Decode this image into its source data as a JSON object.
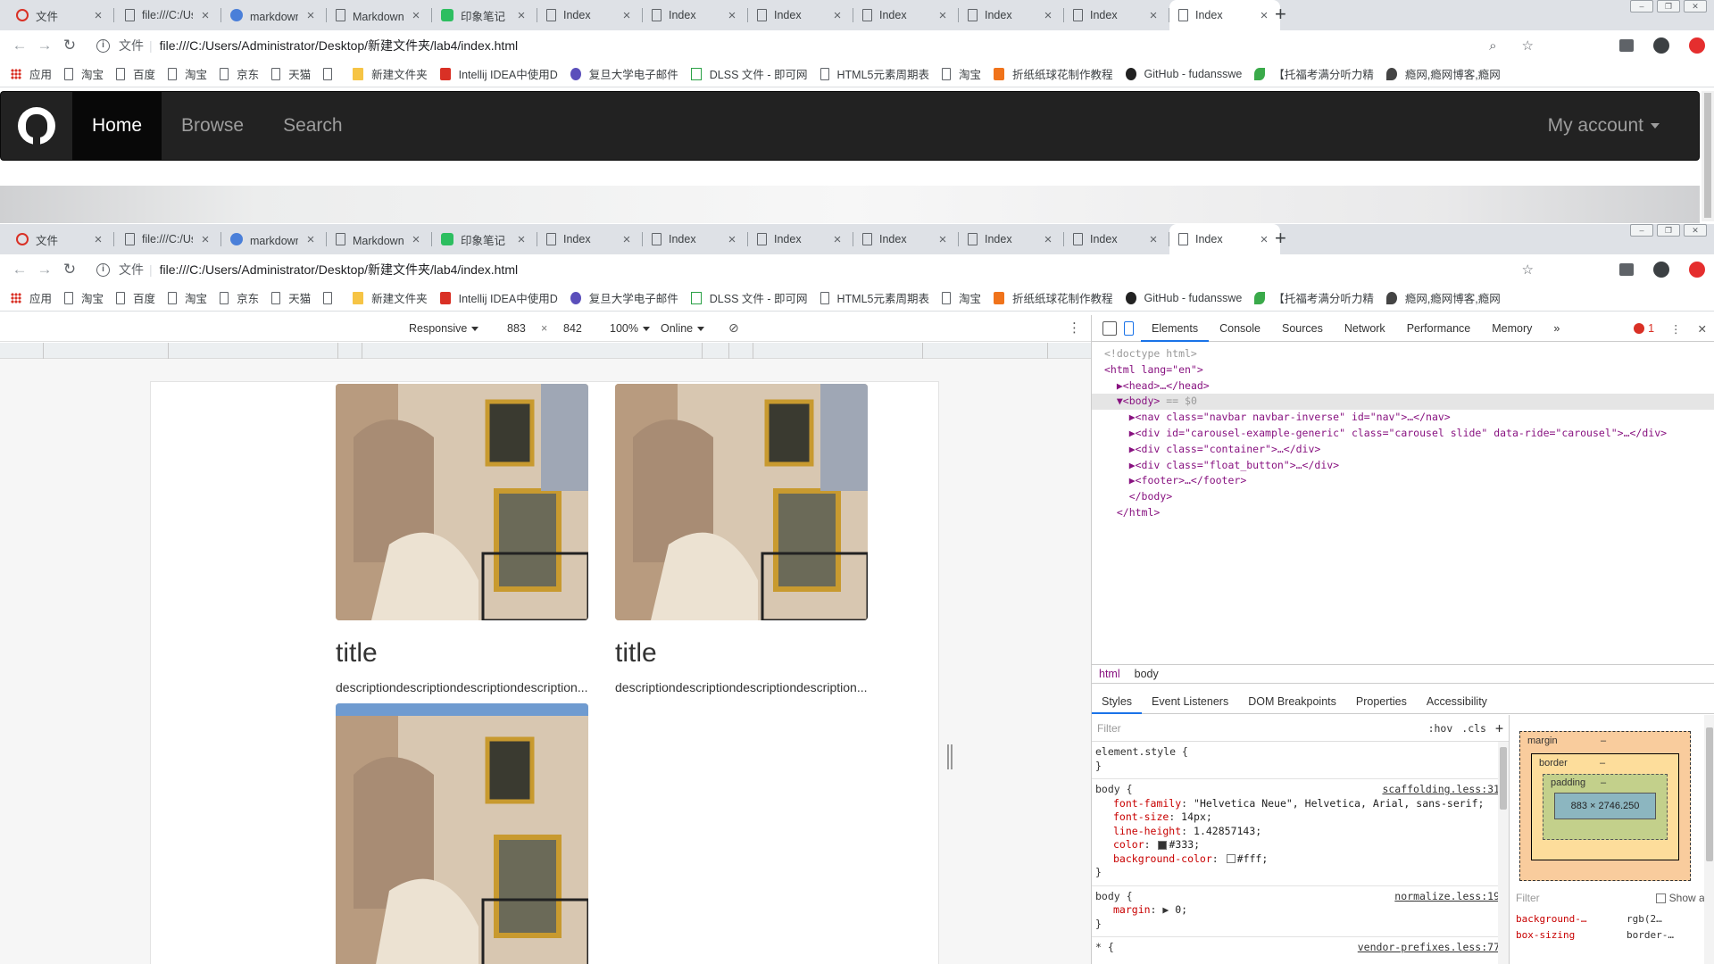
{
  "browser_top": {
    "tabs": [
      {
        "title": "文件",
        "icon": "red-circle-icon"
      },
      {
        "title": "file:///C:/User",
        "icon": "page-icon"
      },
      {
        "title": "markdown编辑",
        "icon": "paw-icon"
      },
      {
        "title": "Markdown在线",
        "icon": "page-icon"
      },
      {
        "title": "印象笔记 Mark",
        "icon": "evernote-icon"
      },
      {
        "title": "Index",
        "icon": "page-icon"
      },
      {
        "title": "Index",
        "icon": "page-icon"
      },
      {
        "title": "Index",
        "icon": "page-icon"
      },
      {
        "title": "Index",
        "icon": "page-icon"
      },
      {
        "title": "Index",
        "icon": "page-icon"
      },
      {
        "title": "Index",
        "icon": "page-icon"
      },
      {
        "title": "Index",
        "icon": "page-icon",
        "active": true
      }
    ],
    "url_scheme_label": "文件",
    "url": "file:///C:/Users/Administrator/Desktop/新建文件夹/lab4/index.html"
  },
  "bookmarks": [
    {
      "label": "应用",
      "icon": "apps-icon"
    },
    {
      "label": "淘宝",
      "icon": "page-icon"
    },
    {
      "label": "百度",
      "icon": "page-icon"
    },
    {
      "label": "淘宝",
      "icon": "page-icon"
    },
    {
      "label": "京东",
      "icon": "page-icon"
    },
    {
      "label": "天猫",
      "icon": "page-icon"
    },
    {
      "label": "",
      "icon": "page-icon"
    },
    {
      "label": "新建文件夹",
      "icon": "folder-icon"
    },
    {
      "label": "Intellij IDEA中使用D",
      "icon": "intellij-icon"
    },
    {
      "label": "复旦大学电子邮件",
      "icon": "globe-icon"
    },
    {
      "label": "DLSS 文件 - 即可网",
      "icon": "jk-icon"
    },
    {
      "label": "HTML5元素周期表",
      "icon": "page-icon"
    },
    {
      "label": "淘宝",
      "icon": "page-icon"
    },
    {
      "label": "折纸纸球花制作教程",
      "icon": "orange-icon"
    },
    {
      "label": "GitHub - fudansswe",
      "icon": "github-icon"
    },
    {
      "label": "【托福考满分听力精",
      "icon": "leaf-icon"
    },
    {
      "label": "瘾网,瘾网博客,瘾网",
      "icon": "chat-icon"
    }
  ],
  "site_navbar": {
    "brand": "github-logo-icon",
    "links": [
      {
        "label": "Home",
        "active": true
      },
      {
        "label": "Browse",
        "active": false
      },
      {
        "label": "Search",
        "active": false
      }
    ],
    "account": "My account"
  },
  "device_toolbar": {
    "mode": "Responsive",
    "width": "883",
    "times": "×",
    "height": "842",
    "zoom": "100%",
    "throttle": "Online"
  },
  "page_content": {
    "cards": [
      {
        "title": "title",
        "description": "descriptiondescriptiondescriptiondescription..."
      },
      {
        "title": "title",
        "description": "descriptiondescriptiondescriptiondescription..."
      },
      {
        "title": "",
        "description": ""
      }
    ]
  },
  "devtools": {
    "tabs": [
      "Elements",
      "Console",
      "Sources",
      "Network",
      "Performance",
      "Memory"
    ],
    "more": "»",
    "error_count": "1",
    "dom": {
      "doctype": "<!doctype html>",
      "html_open": "<html lang=\"en\">",
      "head": "<head>…</head>",
      "body_open": "<body>",
      "body_marker": " == $0",
      "nav": "<nav class=\"navbar navbar-inverse\" id=\"nav\">…</nav>",
      "carousel": "<div id=\"carousel-example-generic\" class=\"carousel slide\" data-ride=\"carousel\">…</div>",
      "container": "<div class=\"container\">…</div>",
      "float_button": "<div class=\"float_button\">…</div>",
      "footer": "<footer>…</footer>",
      "body_close": "</body>",
      "html_close": "</html>"
    },
    "breadcrumbs": [
      "html",
      "body"
    ],
    "sub_tabs": [
      "Styles",
      "Event Listeners",
      "DOM Breakpoints",
      "Properties",
      "Accessibility"
    ],
    "styles": {
      "filter_placeholder": "Filter",
      "hov": ":hov",
      "cls": ".cls",
      "add": "+",
      "element_style": "element.style {",
      "close_brace": "}",
      "rule1_selector": "body {",
      "rule1_source": "scaffolding.less:31",
      "rule1_props": [
        {
          "name": "font-family",
          "value": "\"Helvetica Neue\", Helvetica, Arial, sans-serif;"
        },
        {
          "name": "font-size",
          "value": "14px;"
        },
        {
          "name": "line-height",
          "value": "1.42857143;"
        },
        {
          "name": "color",
          "value": "#333;"
        },
        {
          "name": "background-color",
          "value": "#fff;"
        }
      ],
      "rule2_selector": "body {",
      "rule2_source": "normalize.less:19",
      "rule2_prop": {
        "name": "margin",
        "value": "0;"
      },
      "rule3_selector": "* {",
      "rule3_source": "vendor-prefixes.less:77"
    },
    "computed": {
      "margin_label": "margin",
      "border_label": "border",
      "padding_label": "padding",
      "dash": "–",
      "content_size": "883 × 2746.250",
      "filter_placeholder": "Filter",
      "show_all": "Show all",
      "rows": [
        {
          "key": "background-…",
          "value": "rgb(2…"
        },
        {
          "key": "box-sizing",
          "value": "border-…"
        }
      ]
    }
  },
  "colors": {
    "navbar_bg": "#222222",
    "navbar_active": "#080808",
    "link": "#9d9d9d",
    "devtools_accent": "#1a73e8"
  }
}
